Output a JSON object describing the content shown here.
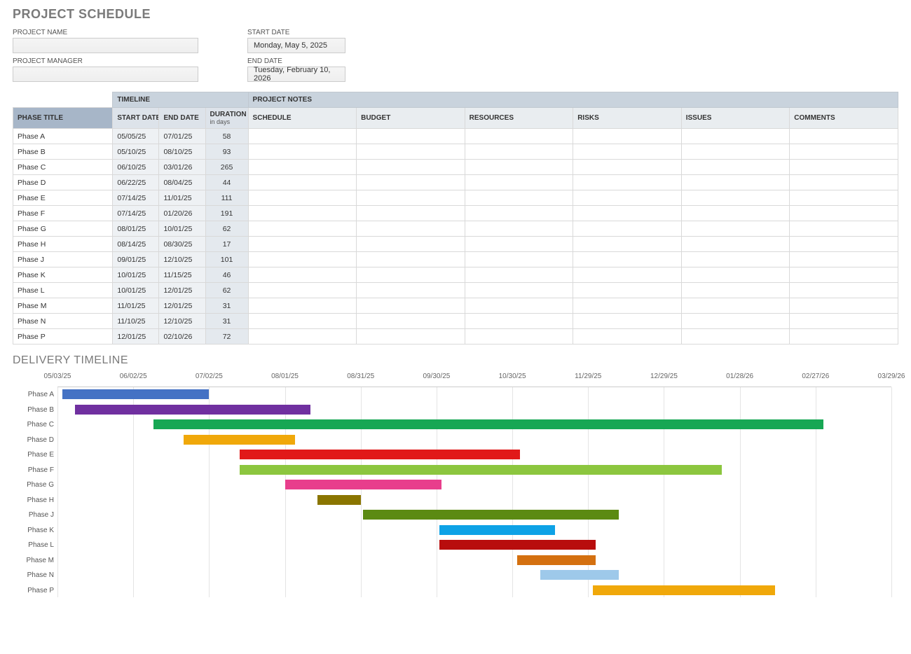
{
  "title": "PROJECT SCHEDULE",
  "info": {
    "project_name_label": "PROJECT NAME",
    "project_name_value": "",
    "project_manager_label": "PROJECT MANAGER",
    "project_manager_value": "",
    "start_date_label": "START DATE",
    "start_date_value": "Monday, May 5, 2025",
    "end_date_label": "END DATE",
    "end_date_value": "Tuesday, February 10, 2026"
  },
  "headers": {
    "timeline": "TIMELINE",
    "project_notes": "PROJECT NOTES",
    "phase_title": "PHASE TITLE",
    "start_date": "START DATE",
    "end_date": "END DATE",
    "duration": "DURATION",
    "duration_sub": "in days",
    "schedule": "SCHEDULE",
    "budget": "BUDGET",
    "resources": "RESOURCES",
    "risks": "RISKS",
    "issues": "ISSUES",
    "comments": "COMMENTS"
  },
  "rows": [
    {
      "phase": "Phase A",
      "start": "05/05/25",
      "end": "07/01/25",
      "dur": "58"
    },
    {
      "phase": "Phase B",
      "start": "05/10/25",
      "end": "08/10/25",
      "dur": "93"
    },
    {
      "phase": "Phase C",
      "start": "06/10/25",
      "end": "03/01/26",
      "dur": "265"
    },
    {
      "phase": "Phase D",
      "start": "06/22/25",
      "end": "08/04/25",
      "dur": "44"
    },
    {
      "phase": "Phase E",
      "start": "07/14/25",
      "end": "11/01/25",
      "dur": "111"
    },
    {
      "phase": "Phase F",
      "start": "07/14/25",
      "end": "01/20/26",
      "dur": "191"
    },
    {
      "phase": "Phase G",
      "start": "08/01/25",
      "end": "10/01/25",
      "dur": "62"
    },
    {
      "phase": "Phase H",
      "start": "08/14/25",
      "end": "08/30/25",
      "dur": "17"
    },
    {
      "phase": "Phase J",
      "start": "09/01/25",
      "end": "12/10/25",
      "dur": "101"
    },
    {
      "phase": "Phase K",
      "start": "10/01/25",
      "end": "11/15/25",
      "dur": "46"
    },
    {
      "phase": "Phase L",
      "start": "10/01/25",
      "end": "12/01/25",
      "dur": "62"
    },
    {
      "phase": "Phase M",
      "start": "11/01/25",
      "end": "12/01/25",
      "dur": "31"
    },
    {
      "phase": "Phase N",
      "start": "11/10/25",
      "end": "12/10/25",
      "dur": "31"
    },
    {
      "phase": "Phase P",
      "start": "12/01/25",
      "end": "02/10/26",
      "dur": "72"
    }
  ],
  "chart_title": "DELIVERY TIMELINE",
  "chart_data": {
    "type": "bar",
    "orientation": "horizontal",
    "xlabel": "",
    "ylabel": "",
    "axis_start": "05/03/25",
    "axis_end": "03/29/26",
    "axis_days": 330,
    "ticks": [
      {
        "label": "05/03/25",
        "offset": 0
      },
      {
        "label": "06/02/25",
        "offset": 30
      },
      {
        "label": "07/02/25",
        "offset": 60
      },
      {
        "label": "08/01/25",
        "offset": 90
      },
      {
        "label": "08/31/25",
        "offset": 120
      },
      {
        "label": "09/30/25",
        "offset": 150
      },
      {
        "label": "10/30/25",
        "offset": 180
      },
      {
        "label": "11/29/25",
        "offset": 210
      },
      {
        "label": "12/29/25",
        "offset": 240
      },
      {
        "label": "01/28/26",
        "offset": 270
      },
      {
        "label": "02/27/26",
        "offset": 300
      },
      {
        "label": "03/29/26",
        "offset": 330
      }
    ],
    "series": [
      {
        "name": "Phase A",
        "start_offset": 2,
        "duration": 58,
        "color": "#4472c4"
      },
      {
        "name": "Phase B",
        "start_offset": 7,
        "duration": 93,
        "color": "#7030a0"
      },
      {
        "name": "Phase C",
        "start_offset": 38,
        "duration": 265,
        "color": "#17a754"
      },
      {
        "name": "Phase D",
        "start_offset": 50,
        "duration": 44,
        "color": "#f0a80a"
      },
      {
        "name": "Phase E",
        "start_offset": 72,
        "duration": 111,
        "color": "#e11919"
      },
      {
        "name": "Phase F",
        "start_offset": 72,
        "duration": 191,
        "color": "#8cc63f"
      },
      {
        "name": "Phase G",
        "start_offset": 90,
        "duration": 62,
        "color": "#e83e8c"
      },
      {
        "name": "Phase H",
        "start_offset": 103,
        "duration": 17,
        "color": "#8a7500"
      },
      {
        "name": "Phase J",
        "start_offset": 121,
        "duration": 101,
        "color": "#5b8a12"
      },
      {
        "name": "Phase K",
        "start_offset": 151,
        "duration": 46,
        "color": "#0ea2e6"
      },
      {
        "name": "Phase L",
        "start_offset": 151,
        "duration": 62,
        "color": "#b80d0d"
      },
      {
        "name": "Phase M",
        "start_offset": 182,
        "duration": 31,
        "color": "#d47010"
      },
      {
        "name": "Phase N",
        "start_offset": 191,
        "duration": 31,
        "color": "#9ec9ea"
      },
      {
        "name": "Phase P",
        "start_offset": 212,
        "duration": 72,
        "color": "#f0a80a"
      }
    ]
  }
}
